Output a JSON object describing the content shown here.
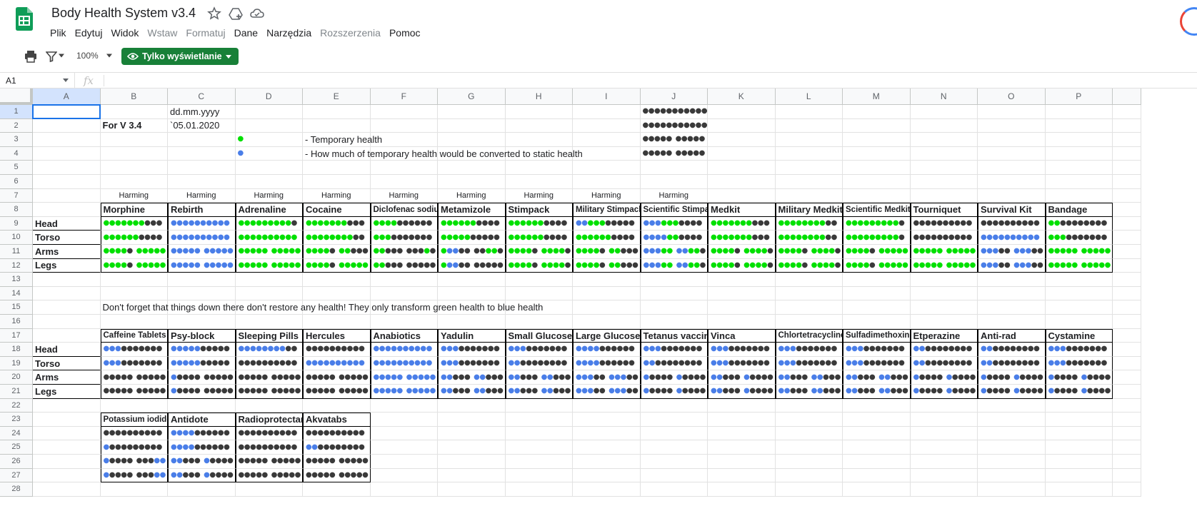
{
  "app": {
    "doc_title": "Body Health System v3.4",
    "menu": [
      "Plik",
      "Edytuj",
      "Widok",
      "Wstaw",
      "Formatuj",
      "Dane",
      "Narzędzia",
      "Rozszerzenia",
      "Pomoc"
    ],
    "menu_disabled": [
      "Wstaw",
      "Formatuj",
      "Rozszerzenia"
    ],
    "icons": [
      "sheets-logo-icon",
      "star-icon",
      "move-to-drive-icon",
      "cloud-status-icon",
      "print-icon",
      "filter-icon",
      "zoom-caret-icon",
      "eye-icon"
    ],
    "colors": {
      "brand_green": "#188038",
      "sheet_selection": "#1a73e8",
      "temp_health": "#00e000",
      "static_health": "#4a7ee8",
      "empty_health": "#3a3a3a"
    }
  },
  "toolbar": {
    "zoom": "100%",
    "view_mode_label": "Tylko wyświetlanie"
  },
  "formula_bar": {
    "name_box": "A1",
    "fx_label": "fx",
    "formula": ""
  },
  "grid": {
    "columns": [
      "A",
      "B",
      "C",
      "D",
      "E",
      "F",
      "G",
      "H",
      "I",
      "J",
      "K",
      "L",
      "M",
      "N",
      "O",
      "P"
    ],
    "rows": [
      "1",
      "2",
      "3",
      "4",
      "5",
      "6",
      "7",
      "8",
      "9",
      "10",
      "11",
      "12",
      "13",
      "14",
      "15",
      "16",
      "17",
      "18",
      "19",
      "20",
      "21",
      "22",
      "23",
      "24",
      "25",
      "26",
      "27",
      "28"
    ]
  },
  "sheet": {
    "date_format": "dd.mm.yyyy",
    "version_label": "For V 3.4",
    "version_date": "`05.01.2020",
    "legend": [
      {
        "marker": "g",
        "text": "- Temporary health"
      },
      {
        "marker": "b",
        "text": "- How much of temporary health would be converted to static health"
      }
    ],
    "j_column_samples": [
      "kkkkkkkkkkk",
      "kkkkkkkkkkk",
      "kkkkk kkkkk",
      "kkkkk kkkkk"
    ],
    "harming_label": "Harming",
    "harming_count": 9,
    "body_parts": [
      "Head",
      "Torso",
      "Arms",
      "Legs"
    ],
    "note": "Don't forget that things down there don't restore any health! They only transform green health to blue health",
    "table1": [
      {
        "name": "Morphine",
        "rows": [
          "gggggggkkk",
          "ggggggkkkk",
          "ggggk ggggg",
          "ggggk ggggg"
        ]
      },
      {
        "name": "Rebirth",
        "rows": [
          "bbbbbbbbbb",
          "bbbbbbbbbb",
          "bbbbb bbbbb",
          "bbbbb bbbbb"
        ]
      },
      {
        "name": "Adrenaline",
        "rows": [
          "gggggggggk",
          "gggggggggg",
          "ggggg ggggg",
          "ggggg ggggg"
        ]
      },
      {
        "name": "Cocaine",
        "rows": [
          "gggggggkkk",
          "ggggggggkk",
          "ggggk ggkkk",
          "ggggk ggggg"
        ]
      },
      {
        "name": "Diclofenac sodium",
        "rows": [
          "ggggkkkkkk",
          "gggkkkkkkk",
          "ggkkk kkkgk",
          "ggkkk kkkkk"
        ]
      },
      {
        "name": "Metamizole",
        "rows": [
          "ggggggkkkk",
          "gggggkkkkk",
          "gbbkk kkggk",
          "gbbkk kkkkk"
        ]
      },
      {
        "name": "Stimpack",
        "rows": [
          "ggggggkkkk",
          "ggggggkkkk",
          "ggggk ggggk",
          "ggggk ggggk"
        ]
      },
      {
        "name": "Military Stimpack",
        "rows": [
          "bbgggkkkkk",
          "ggggggkkkk",
          "ggggk ggkkk",
          "ggggk ggkkk"
        ]
      },
      {
        "name": "Scientific Stimpack",
        "rows": [
          "bbbgggkkkk",
          "bbbbggkkkk",
          "bbbgg bbggk",
          "bbbgg bbggk"
        ]
      },
      {
        "name": "Medkit",
        "rows": [
          "gggggggkkk",
          "gggggggkkk",
          "ggggk ggggk",
          "ggggk ggggk"
        ]
      },
      {
        "name": "Military Medkit",
        "rows": [
          "ggggggggkk",
          "ggggggggkk",
          "ggggk ggggk",
          "ggggk ggggk"
        ]
      },
      {
        "name": "Scientific Medkit",
        "rows": [
          "gggggggggk",
          "gggggggggk",
          "ggggk ggggg",
          "ggggk ggggg"
        ]
      },
      {
        "name": "Tourniquet",
        "rows": [
          "kkkkkkkkkk",
          "kkkkkkkkkk",
          "ggggg ggggg",
          "ggggg ggggg"
        ]
      },
      {
        "name": "Survival Kit",
        "rows": [
          "kkkkkkkkkk",
          "bbbbbbbbbb",
          "bbbkk bbbkk",
          "bbbkk bbbkk"
        ]
      },
      {
        "name": "Bandage",
        "rows": [
          "ggkkkkkkkk",
          "gggkkkkkkk",
          "ggggg ggggg",
          "ggggg ggggg"
        ]
      }
    ],
    "table2": [
      {
        "name": "Caffeine Tablets",
        "rows": [
          "bbbkkkkkkk",
          "bbbkkkkkkk",
          "kkkkk kkkkk",
          "kkkkk kkkkk"
        ]
      },
      {
        "name": "Psy-block",
        "rows": [
          "bbbbbkkkkk",
          "bbbbbkkkkk",
          "bkkkk kkkkk",
          "bkkkk kkkkk"
        ]
      },
      {
        "name": "Sleeping Pills",
        "rows": [
          "bbbbbbbbkk",
          "kkkkkkkkkk",
          "kkkkk kkkkk",
          "kkkkk kkkkk"
        ]
      },
      {
        "name": "Hercules",
        "rows": [
          "kkkkkkkkkk",
          "bbbbbbbbbb",
          "kkkkk kkkkk",
          "kkkkk kkkkk"
        ]
      },
      {
        "name": "Anabiotics",
        "rows": [
          "bbbbbbbbbb",
          "bbbbbbbbbb",
          "bbbbb bbbbb",
          "bbbbb bbbbb"
        ]
      },
      {
        "name": "Yadulin",
        "rows": [
          "bbbkkkkkkk",
          "bbbkkkkkkk",
          "bbkkk bbkkk",
          "bbkkk bbkkk"
        ]
      },
      {
        "name": "Small Glucose",
        "rows": [
          "bbbkkkkkkk",
          "bbkkkkkkkk",
          "bbkkk bbkkk",
          "bbkkk bbkkk"
        ]
      },
      {
        "name": "Large Glucose",
        "rows": [
          "bbbbkkkkkk",
          "bbbbkkkkkk",
          "bbbkk bbbkk",
          "bbbkk bbbkk"
        ]
      },
      {
        "name": "Tetanus vaccine",
        "rows": [
          "bbbkkkkkkk",
          "bbkkkkkkkk",
          "bkkkk bkkkk",
          "bkkkk bkkkk"
        ]
      },
      {
        "name": "Vinca",
        "rows": [
          "bbbkkkkkkk",
          "bbbkkkkkkk",
          "bbkkk bkkkk",
          "bbkkk bkkkk"
        ]
      },
      {
        "name": "Chlortetracycline",
        "rows": [
          "bbbkkkkkkk",
          "bbbkkkkkkk",
          "bbkkk bbkkk",
          "bbkkk bbkkk"
        ]
      },
      {
        "name": "Sulfadimethoxine",
        "rows": [
          "bbbkkkkkkk",
          "bbbkkkkkkk",
          "bbkkk bbkkk",
          "bbkkk bbkkk"
        ]
      },
      {
        "name": "Etperazine",
        "rows": [
          "bbkkkkkkkk",
          "bbkkkkkkkk",
          "bkkkk bkkkk",
          "bkkkk bkkkk"
        ]
      },
      {
        "name": "Anti-rad",
        "rows": [
          "bbkkkkkkkk",
          "bbkkkkkkkk",
          "bkkkk bkkkk",
          "bkkkk bkkkk"
        ]
      },
      {
        "name": "Cystamine",
        "rows": [
          "bbbkkkkkkk",
          "bbbkkkkkkk",
          "bkkkk bkkkk",
          "bkkkk bkkkk"
        ]
      }
    ],
    "table3": [
      {
        "name": "Potassium iodide",
        "rows": [
          "kkkkkkkkkk",
          "bkkkkkkkkk",
          "bkkkk kkkbb",
          "bkkkk kkkbb"
        ]
      },
      {
        "name": "Antidote",
        "rows": [
          "bbbbkkkkkk",
          "bbbbkkkkkk",
          "bbkkk bkkkk",
          "bbkkk bkkkk"
        ]
      },
      {
        "name": "Radioprotectant",
        "rows": [
          "kkkkkkkkkk",
          "kkkkkkkkkk",
          "kkkkk kkkkk",
          "kkkkk kkkkk"
        ]
      },
      {
        "name": "Akvatabs",
        "rows": [
          "kkkkkkkkkk",
          "bbkkkkkkkk",
          "kkkkk kkkkk",
          "kkkkk kkkkk"
        ]
      }
    ]
  }
}
